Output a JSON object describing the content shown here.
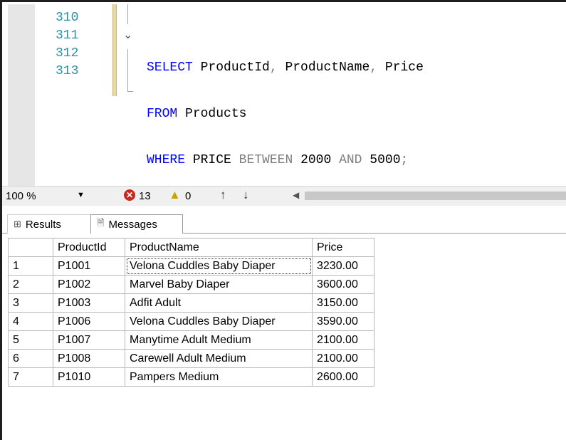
{
  "editor": {
    "line_numbers": [
      "310",
      "311",
      "312",
      "313"
    ],
    "lines": [
      {
        "kw1": "SELECT",
        "text1": " ProductId",
        "op1": ",",
        "text2": " ProductName",
        "op2": ",",
        "text3": " Price"
      },
      {
        "kw1": "FROM",
        "text1": " Products"
      },
      {
        "kw1": "WHERE",
        "text1": " PRICE ",
        "op1": "BETWEEN",
        "num1": " 2000 ",
        "op2": "AND",
        "num2": " 5000",
        "op3": ";"
      }
    ]
  },
  "status": {
    "zoom": "100 %",
    "errors": "13",
    "warnings": "0"
  },
  "tabs": {
    "results_label": "Results",
    "messages_label": "Messages"
  },
  "grid": {
    "headers": [
      "",
      "ProductId",
      "ProductName",
      "Price"
    ],
    "rows": [
      [
        "1",
        "P1001",
        "Velona Cuddles Baby Diaper",
        "3230.00"
      ],
      [
        "2",
        "P1002",
        "Marvel Baby Diaper",
        "3600.00"
      ],
      [
        "3",
        "P1003",
        "Adfit Adult",
        "3150.00"
      ],
      [
        "4",
        "P1006",
        "Velona Cuddles Baby Diaper",
        "3590.00"
      ],
      [
        "5",
        "P1007",
        "Manytime Adult Medium",
        "2100.00"
      ],
      [
        "6",
        "P1008",
        "Carewell Adult Medium",
        "2100.00"
      ],
      [
        "7",
        "P1010",
        "Pampers Medium",
        "2600.00"
      ]
    ]
  },
  "colors": {
    "keyword": "#0000ff",
    "line_number": "#2b91af",
    "operator": "#808080",
    "error": "#c42b1c",
    "warning": "#c9a400"
  },
  "icons": {
    "error": "error-circle-icon",
    "warning": "warning-triangle-icon",
    "results": "grid-icon",
    "messages": "document-icon"
  }
}
